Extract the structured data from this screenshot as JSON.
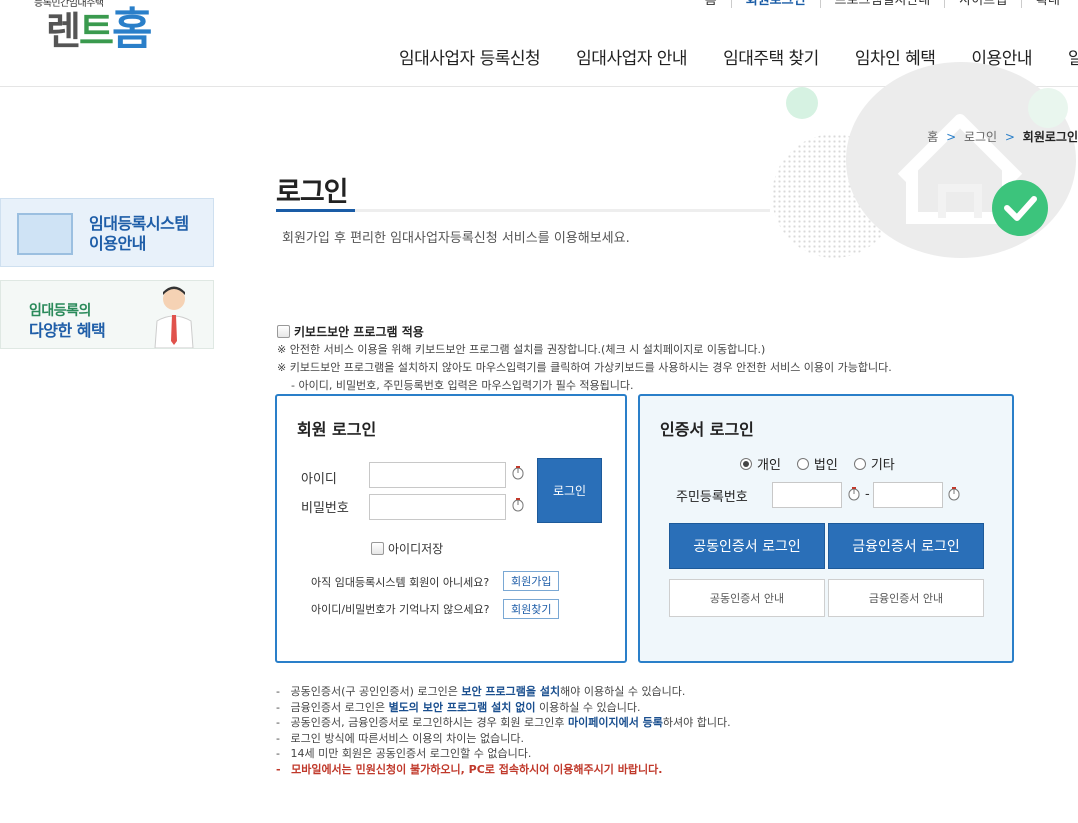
{
  "logo": {
    "subtitle": "등록민간임대주택",
    "part1": "렌",
    "part2": "트",
    "part3": "홈"
  },
  "util_bar": [
    {
      "label": "홈",
      "active": false
    },
    {
      "label": "회원로그인",
      "active": true
    },
    {
      "label": "프로그램설치안내",
      "active": false
    },
    {
      "label": "사이트맵",
      "active": false
    },
    {
      "label": "확대",
      "active": false
    }
  ],
  "gnb": [
    "임대사업자 등록신청",
    "임대사업자 안내",
    "임대주택 찾기",
    "임차인 혜택",
    "이용안내",
    "알림"
  ],
  "breadcrumb": {
    "home": "홈",
    "sep1": ">",
    "item1": "로그인",
    "sep2": ">",
    "current": "회원로그인"
  },
  "page": {
    "title": "로그인",
    "description": "회원가입 후 편리한 임대사업자등록신청 서비스를 이용해보세요."
  },
  "banners": {
    "b1_line1": "임대등록시스템",
    "b1_line2": "이용안내",
    "b2_line1": "임대등록의",
    "b2_line2": "다양한 혜택"
  },
  "keyboard": {
    "label": "키보드보안 프로그램 적용",
    "notice1": "※ 안전한 서비스 이용을 위해 키보드보안 프로그램 설치를 권장합니다.(체크 시 설치페이지로 이동합니다.)",
    "notice2": "※ 키보드보안 프로그램을 설치하지 않아도 마우스입력기를 클릭하여 가상키보드를 사용하시는 경우 안전한 서비스 이용이 가능합니다.",
    "notice3": "- 아이디, 비밀번호, 주민등록번호 입력은 마우스입력기가 필수 적용됩니다."
  },
  "member_login": {
    "title": "회원 로그인",
    "id_label": "아이디",
    "pw_label": "비밀번호",
    "login_button": "로그인",
    "save_id": "아이디저장",
    "q1": "아직 임대등록시스템 회원이 아니세요?",
    "join_button": "회원가입",
    "q2": "아이디/비밀번호가 기억나지 않으세요?",
    "find_button": "회원찾기"
  },
  "cert_login": {
    "title": "인증서 로그인",
    "radio_personal": "개인",
    "radio_corp": "법인",
    "radio_etc": "기타",
    "rrn_label": "주민등록번호",
    "dash": "-",
    "joint_cert_button": "공동인증서 로그인",
    "fin_cert_button": "금융인증서 로그인",
    "joint_guide": "공동인증서 안내",
    "fin_guide": "금융인증서 안내"
  },
  "notes": {
    "n1a": "공동인증서(구 공인인증서) 로그인은 ",
    "n1b": "보안 프로그램을 설치",
    "n1c": "해야 이용하실 수 있습니다.",
    "n2a": "금융인증서 로그인은 ",
    "n2b": "별도의 보안 프로그램 설치 없이",
    "n2c": " 이용하실 수 있습니다.",
    "n3a": "공동인증서, 금융인증서로 로그인하시는 경우 회원 로그인후 ",
    "n3b": "마이페이지에서 등록",
    "n3c": "하셔야 합니다.",
    "n4": "로그인 방식에 따른서비스 이용의 차이는 없습니다.",
    "n5": "14세 미만 회원은 공동인증서 로그인할 수 없습니다.",
    "n6": "모바일에서는 민원신청이 불가하오니, PC로 접속하시어 이용해주시기 바랍니다.",
    "dash": "-"
  }
}
